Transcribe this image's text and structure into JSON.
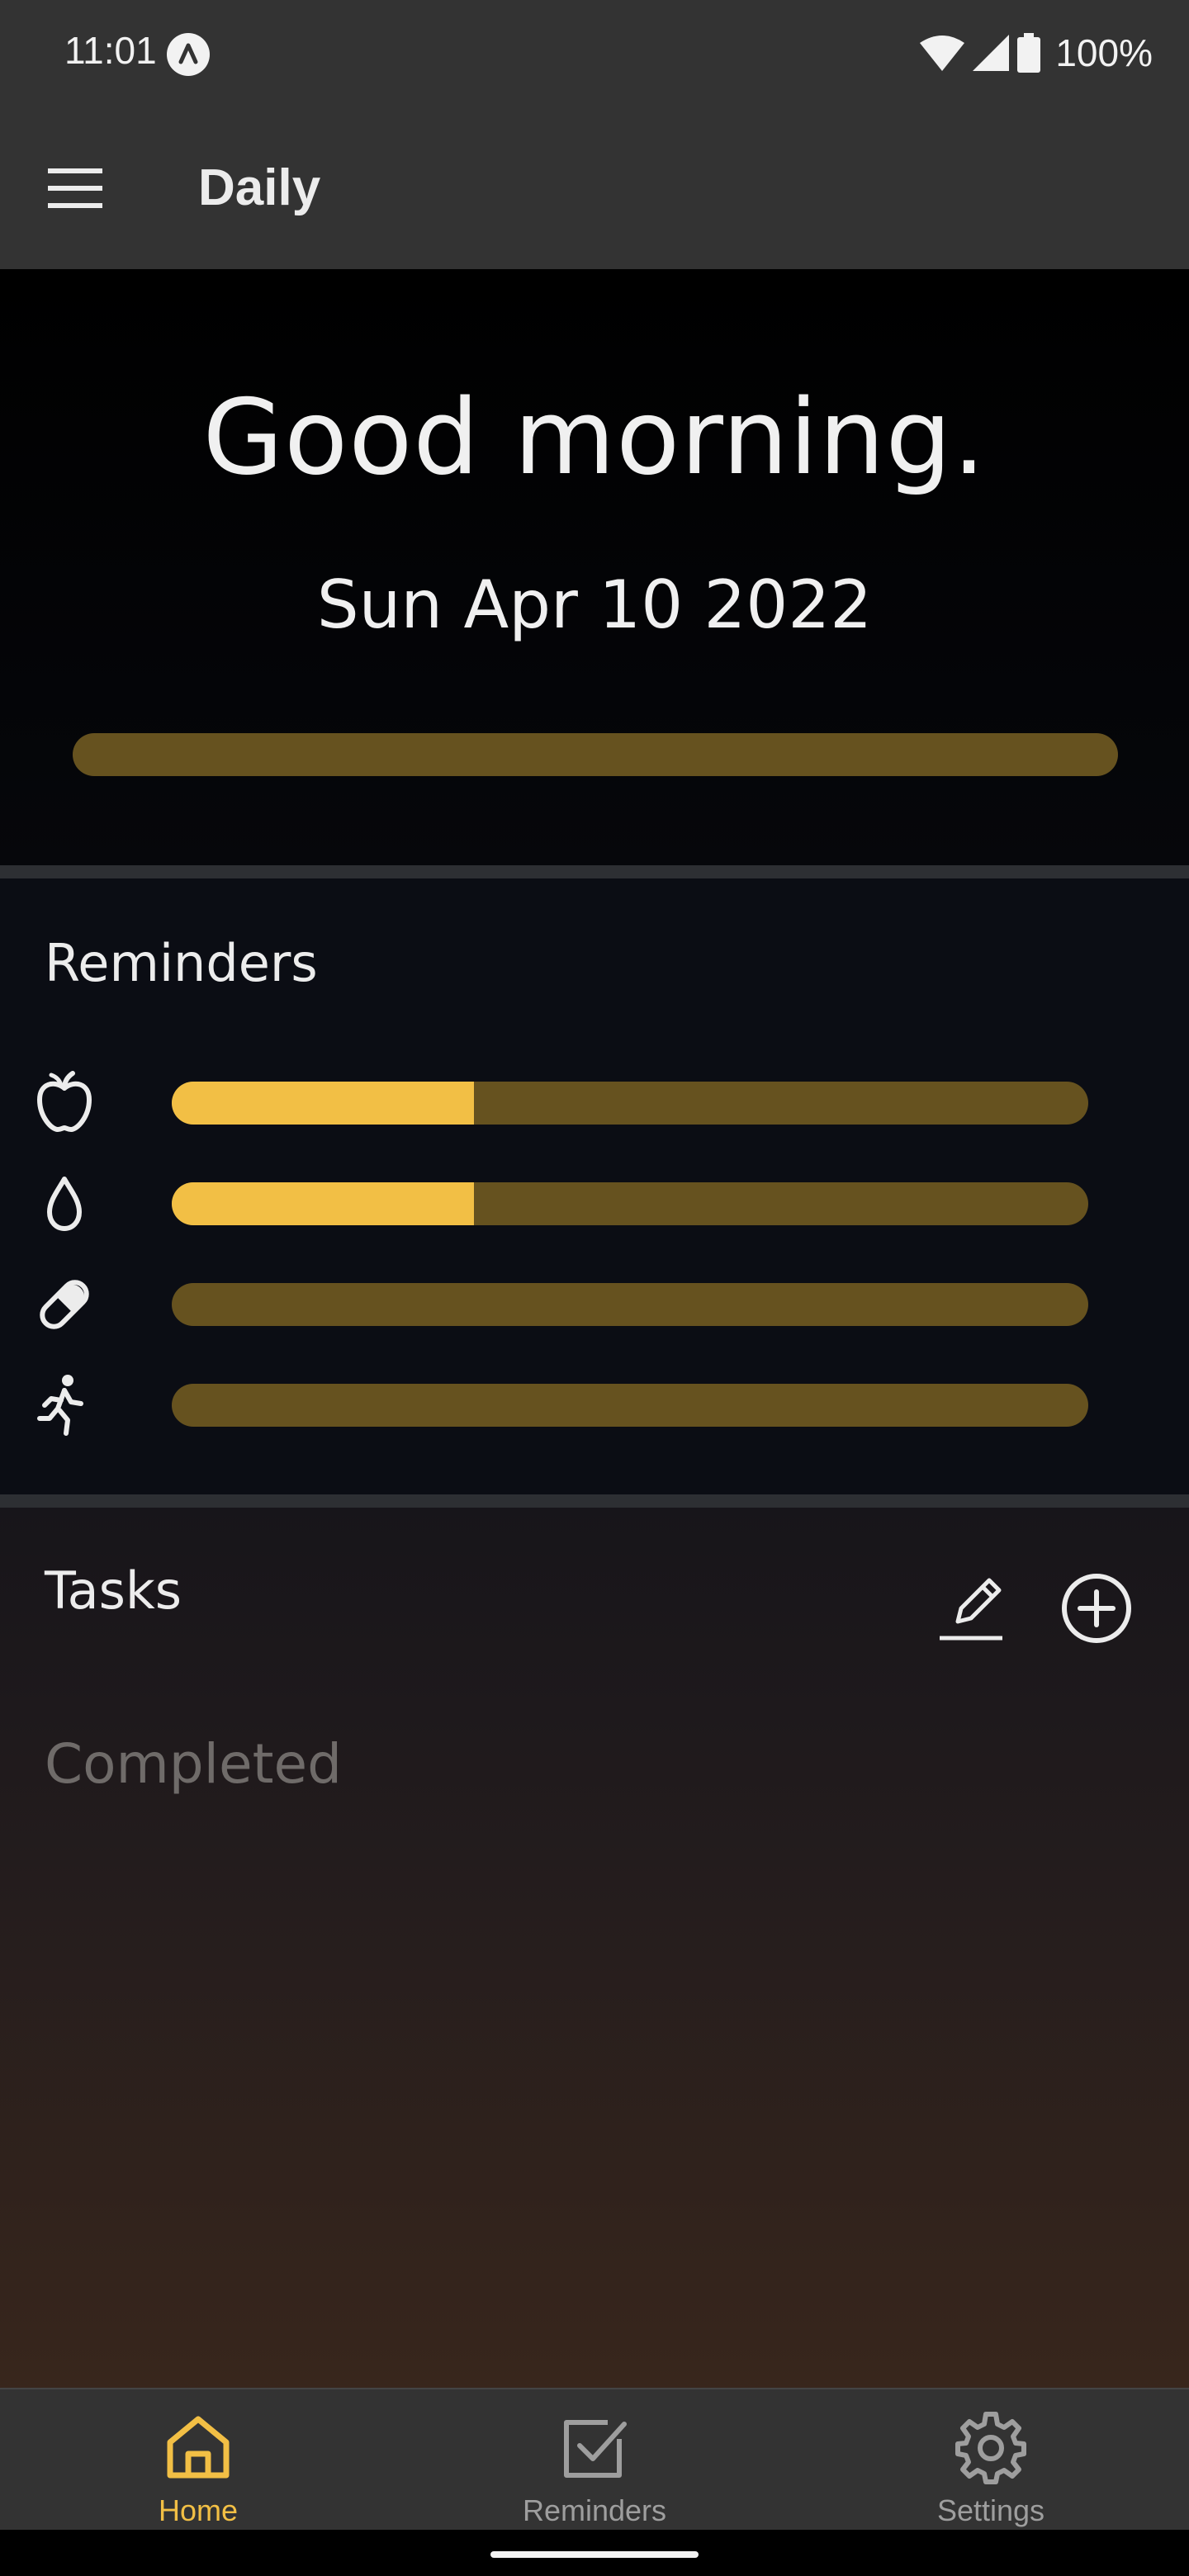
{
  "status_bar": {
    "time": "11:01",
    "battery_percent": "100%",
    "icons": [
      "notification-a-icon",
      "wifi-icon",
      "signal-icon",
      "battery-icon"
    ]
  },
  "app_bar": {
    "title": "Daily",
    "menu_icon": "hamburger-menu-icon"
  },
  "header": {
    "greeting": "Good morning.",
    "date": "Sun Apr 10 2022",
    "day_progress": 0
  },
  "reminders": {
    "title": "Reminders",
    "items": [
      {
        "icon": "apple-icon",
        "progress": 0.33
      },
      {
        "icon": "water-drop-icon",
        "progress": 0.33
      },
      {
        "icon": "pill-icon",
        "progress": 0
      },
      {
        "icon": "running-icon",
        "progress": 0
      }
    ]
  },
  "tasks": {
    "title": "Tasks",
    "edit_icon": "pencil-icon",
    "add_icon": "add-circle-icon",
    "completed_label": "Completed"
  },
  "bottom_nav": {
    "items": [
      {
        "label": "Home",
        "icon": "home-icon",
        "active": true
      },
      {
        "label": "Reminders",
        "icon": "checkbox-icon",
        "active": false
      },
      {
        "label": "Settings",
        "icon": "gear-icon",
        "active": false
      }
    ]
  },
  "colors": {
    "accent": "#f2bf45",
    "track": "#66521f",
    "bar_background": "#333333",
    "inactive_nav": "#9e9e9e"
  }
}
